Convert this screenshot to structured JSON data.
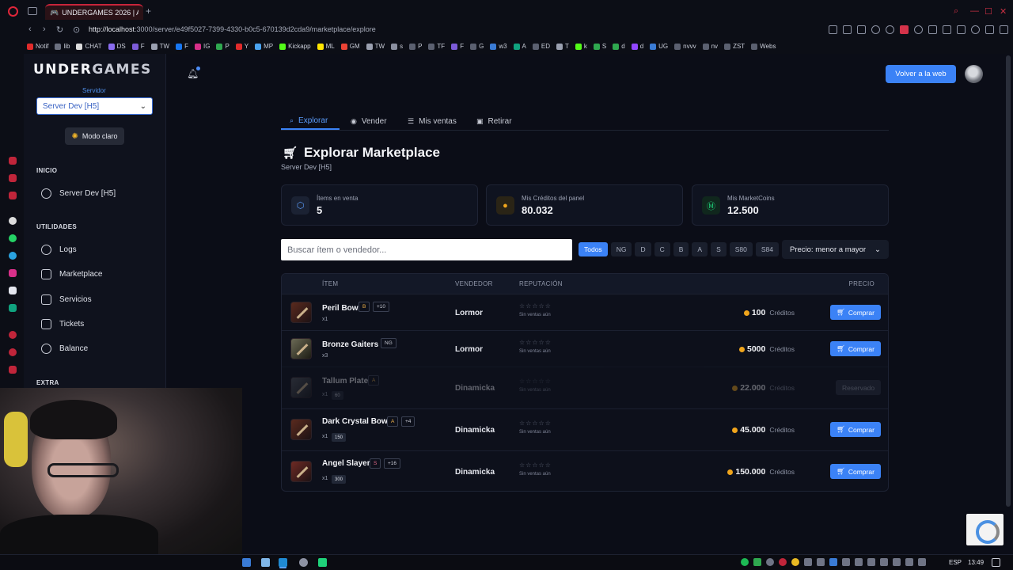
{
  "browser": {
    "tab_title": "UNDERGAMES 2026 | Acc",
    "new_tab_label": "+",
    "url_host": "http://localhost",
    "url_path": ":3000/server/e49f5027-7399-4330-b0c5-670139d2cda9/marketplace/explore",
    "bookmarks": [
      "Notif",
      "lib",
      "CHAT",
      "DS",
      "F",
      "TW",
      "F",
      "IG",
      "P",
      "Y",
      "MP",
      "Kickapp",
      "ML",
      "GM",
      "TW",
      "s",
      "P",
      "TF",
      "F",
      "G",
      "w3",
      "A",
      "ED",
      "T",
      "k",
      "S",
      "d",
      "d",
      "UG",
      "nvvv",
      "nv",
      "ZST",
      "Webs"
    ]
  },
  "sidebar": {
    "logo_a": "UNDER",
    "logo_b": "GAMES",
    "server_label": "Servidor",
    "server_selected": "Server Dev [H5]",
    "mode_button": "Modo claro",
    "sections": {
      "inicio": "INICIO",
      "utilidades": "UTILIDADES",
      "extra": "EXTRA"
    },
    "inicio_items": [
      "Server Dev [H5]"
    ],
    "util_items": [
      "Logs",
      "Marketplace",
      "Servicios",
      "Tickets",
      "Balance"
    ]
  },
  "header": {
    "back_button": "Volver a la web"
  },
  "tabs": [
    "Explorar",
    "Vender",
    "Mis ventas",
    "Retirar"
  ],
  "page": {
    "title": "Explorar Marketplace",
    "subtitle": "Server Dev [H5]"
  },
  "stats": [
    {
      "label": "Ítems en venta",
      "value": "5",
      "icon": "cubes-icon"
    },
    {
      "label": "Mis Créditos del panel",
      "value": "80.032",
      "icon": "coins-icon"
    },
    {
      "label": "Mis MarketCoins",
      "value": "12.500",
      "icon": "marketcoin-icon"
    }
  ],
  "filters": {
    "search_placeholder": "Buscar ítem o vendedor...",
    "chips": [
      "Todos",
      "NG",
      "D",
      "C",
      "B",
      "A",
      "S",
      "S80",
      "S84"
    ],
    "sort_selected": "Precio: menor a mayor"
  },
  "table": {
    "headers": {
      "item": "ÍTEM",
      "seller": "VENDEDOR",
      "reputation": "REPUTACIÓN",
      "price": "PRECIO"
    },
    "stars": "☆☆☆☆☆",
    "no_sales": "Sin ventas aún",
    "currency": "Créditos",
    "buy_label": "Comprar",
    "reserved_label": "Reservado",
    "rows": [
      {
        "name": "Peril Bow",
        "grade": "B",
        "enchant": "+10",
        "qty": "x1",
        "pvp": "",
        "seller": "Lormor",
        "price": "100",
        "status": "available"
      },
      {
        "name": "Bronze Gaiters",
        "grade": "NG",
        "enchant": "",
        "qty": "x3",
        "pvp": "",
        "seller": "Lormor",
        "price": "5000",
        "status": "available"
      },
      {
        "name": "Tallum Plate",
        "grade": "A",
        "enchant": "",
        "qty": "x1",
        "pvp": "60",
        "seller": "Dinamicka",
        "price": "22.000",
        "status": "reserved"
      },
      {
        "name": "Dark Crystal Bow",
        "grade": "A",
        "enchant": "+4",
        "qty": "x1",
        "pvp": "150",
        "seller": "Dinamicka",
        "price": "45.000",
        "status": "available"
      },
      {
        "name": "Angel Slayer",
        "grade": "S",
        "enchant": "+16",
        "qty": "x1",
        "pvp": "300",
        "seller": "Dinamicka",
        "price": "150.000",
        "status": "available"
      }
    ]
  },
  "taskbar": {
    "lang": "ESP",
    "clock": "13:49"
  },
  "colors": {
    "accent": "#3b82f6",
    "background": "#0b0d17",
    "coin": "#f0a51c",
    "browser_accent": "#e0263a"
  }
}
